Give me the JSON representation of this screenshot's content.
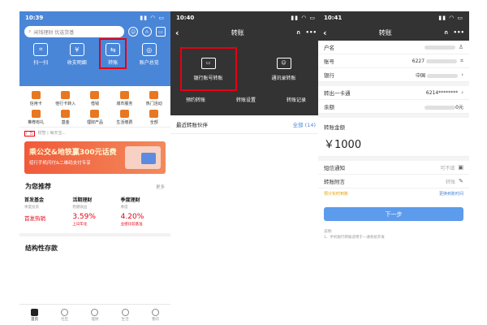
{
  "phone1": {
    "time": "10:39",
    "search_placeholder": "闲钱理财 优选货基",
    "quick_actions": [
      {
        "label": "扫一扫",
        "icon": "scan-icon"
      },
      {
        "label": "收支明细",
        "icon": "yen-icon"
      },
      {
        "label": "转账",
        "icon": "transfer-icon"
      },
      {
        "label": "账户总览",
        "icon": "account-icon"
      }
    ],
    "grid_items": [
      {
        "label": "信用卡",
        "color": "#e87722"
      },
      {
        "label": "他行卡转入",
        "color": "#e87722"
      },
      {
        "label": "借钱",
        "color": "#e87722"
      },
      {
        "label": "城市服务",
        "color": "#e87722"
      },
      {
        "label": "热门活动",
        "color": "#e87722"
      },
      {
        "label": "推荐有礼",
        "color": "#e87722"
      },
      {
        "label": "基金",
        "color": "#e87722"
      },
      {
        "label": "理财产品",
        "color": "#e87722"
      },
      {
        "label": "生活缴费",
        "color": "#e87722"
      },
      {
        "label": "全部",
        "color": "#e87722"
      }
    ],
    "ticker_ad": "广告",
    "ticker_text": "财智 | 每天宝...",
    "banner_title": "乘公交&地铁赢300元话费",
    "banner_sub": "招行手机闪付&二维码支付专享",
    "recommend_title": "为您推荐",
    "recommend_more": "更多",
    "recs": [
      {
        "title": "首发基金",
        "sub": "季度投资",
        "value": "首发热销",
        "note": ""
      },
      {
        "title": "活期理财",
        "sub": "稳健收益",
        "value": "3.59%",
        "note": "上日年化"
      },
      {
        "title": "季度理财",
        "sub": "季度",
        "value": "4.20%",
        "note": "业绩比较基准"
      }
    ],
    "structured_title": "结构性存款",
    "tabs": [
      {
        "label": "首页",
        "active": true
      },
      {
        "label": "社区",
        "active": false
      },
      {
        "label": "理财",
        "active": false
      },
      {
        "label": "生活",
        "active": false
      },
      {
        "label": "我的",
        "active": false
      }
    ]
  },
  "phone2": {
    "time": "10:40",
    "title": "转账",
    "options": [
      {
        "label": "银行账号转账",
        "icon": "card-icon"
      },
      {
        "label": "通讯录转账",
        "icon": "contacts-icon"
      }
    ],
    "sub_options": [
      "预约转账",
      "转账设置",
      "转账记录"
    ],
    "recent_label": "最近转账伙伴",
    "recent_all": "全部 (14)"
  },
  "phone3": {
    "time": "10:41",
    "title": "转账",
    "fields": [
      {
        "label": "户名",
        "value": "",
        "icon": "person-icon"
      },
      {
        "label": "账号",
        "value": "6227",
        "icon": "scan-icon"
      },
      {
        "label": "银行",
        "value": "中国",
        "icon": "chevron-icon"
      }
    ],
    "out_card_label": "转出一卡通",
    "out_card_value": "6214********",
    "balance_label": "余额",
    "balance_value": "0元",
    "amount_label": "转账金额",
    "amount_value": "￥1000",
    "sms_label": "短信通知",
    "sms_value": "可不填",
    "memo_label": "转账附言",
    "memo_value": "转账",
    "hint_left": "预计实时到账",
    "hint_right": "更换到账时间",
    "next_button": "下一步",
    "notes_title": "说明:",
    "notes_text": "1、手机银行转账适用于一通系统开发"
  }
}
